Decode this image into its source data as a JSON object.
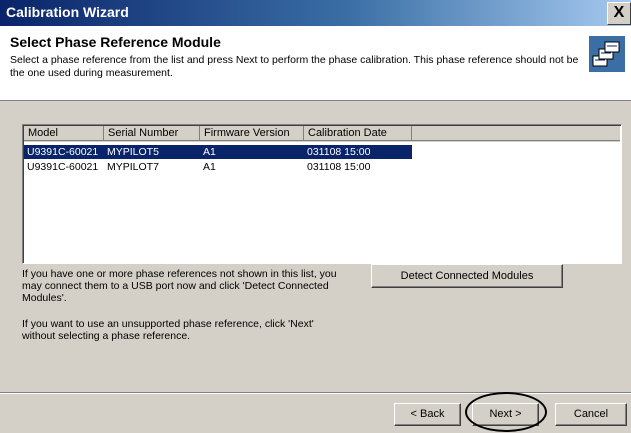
{
  "window": {
    "title": "Calibration Wizard",
    "close_glyph": "X"
  },
  "header": {
    "title": "Select Phase Reference Module",
    "description": "Select a phase reference from the list and press Next to perform the phase calibration. This phase reference should not be the one used during measurement."
  },
  "list": {
    "columns": [
      "Model",
      "Serial Number",
      "Firmware Version",
      "Calibration Date"
    ],
    "rows": [
      {
        "model": "U9391C-60021",
        "serial": "MYPILOT5",
        "firmware": "A1",
        "date": "031108 15:00",
        "selected": true
      },
      {
        "model": "U9391C-60021",
        "serial": "MYPILOT7",
        "firmware": "A1",
        "date": "031108 15:00",
        "selected": false
      }
    ]
  },
  "info": {
    "text1": "If you have one or more phase references not shown in this list, you may connect them to a USB port now and click 'Detect Connected Modules'.",
    "text2": "If you want to use an unsupported phase reference, click 'Next' without selecting a phase reference."
  },
  "buttons": {
    "detect": "Detect Connected Modules",
    "back": "< Back",
    "next": "Next >",
    "cancel": "Cancel"
  },
  "colors": {
    "selection": "#0a246a",
    "title_start": "#0a246a",
    "title_end": "#a6caf0"
  }
}
